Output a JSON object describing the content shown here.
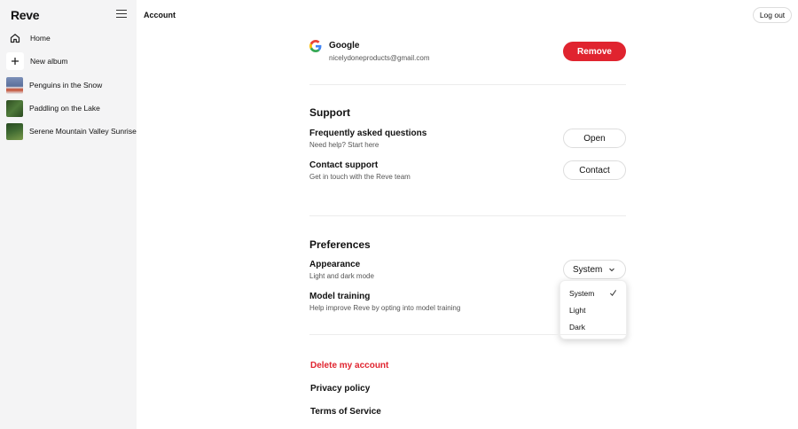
{
  "app": {
    "logo": "Reve",
    "header_title": "Account",
    "logout_label": "Log out"
  },
  "sidebar": {
    "items": [
      {
        "label": "Home",
        "icon": "home-icon"
      },
      {
        "label": "New album",
        "icon": "plus-icon"
      },
      {
        "label": "Penguins in the Snow",
        "thumb_color": "#6a7ea8"
      },
      {
        "label": "Paddling on the Lake",
        "thumb_color": "#3f6b2e"
      },
      {
        "label": "Serene Mountain Valley Sunrise",
        "thumb_color": "#2f5a2a"
      }
    ]
  },
  "account": {
    "provider": "Google",
    "email": "nicelydoneproducts@gmail.com",
    "remove_label": "Remove"
  },
  "support": {
    "heading": "Support",
    "faq": {
      "title": "Frequently asked questions",
      "subtitle": "Need help? Start here",
      "button": "Open"
    },
    "contact": {
      "title": "Contact support",
      "subtitle": "Get in touch with the Reve team",
      "button": "Contact"
    }
  },
  "preferences": {
    "heading": "Preferences",
    "appearance": {
      "title": "Appearance",
      "subtitle": "Light and dark mode",
      "selected": "System"
    },
    "appearance_options": [
      "System",
      "Light",
      "Dark"
    ],
    "model_training": {
      "title": "Model training",
      "subtitle": "Help improve Reve by opting into model training"
    }
  },
  "links": {
    "delete": "Delete my account",
    "privacy": "Privacy policy",
    "terms": "Terms of Service"
  },
  "colors": {
    "accent_red": "#e0242f",
    "sidebar_bg": "#f4f4f5"
  }
}
